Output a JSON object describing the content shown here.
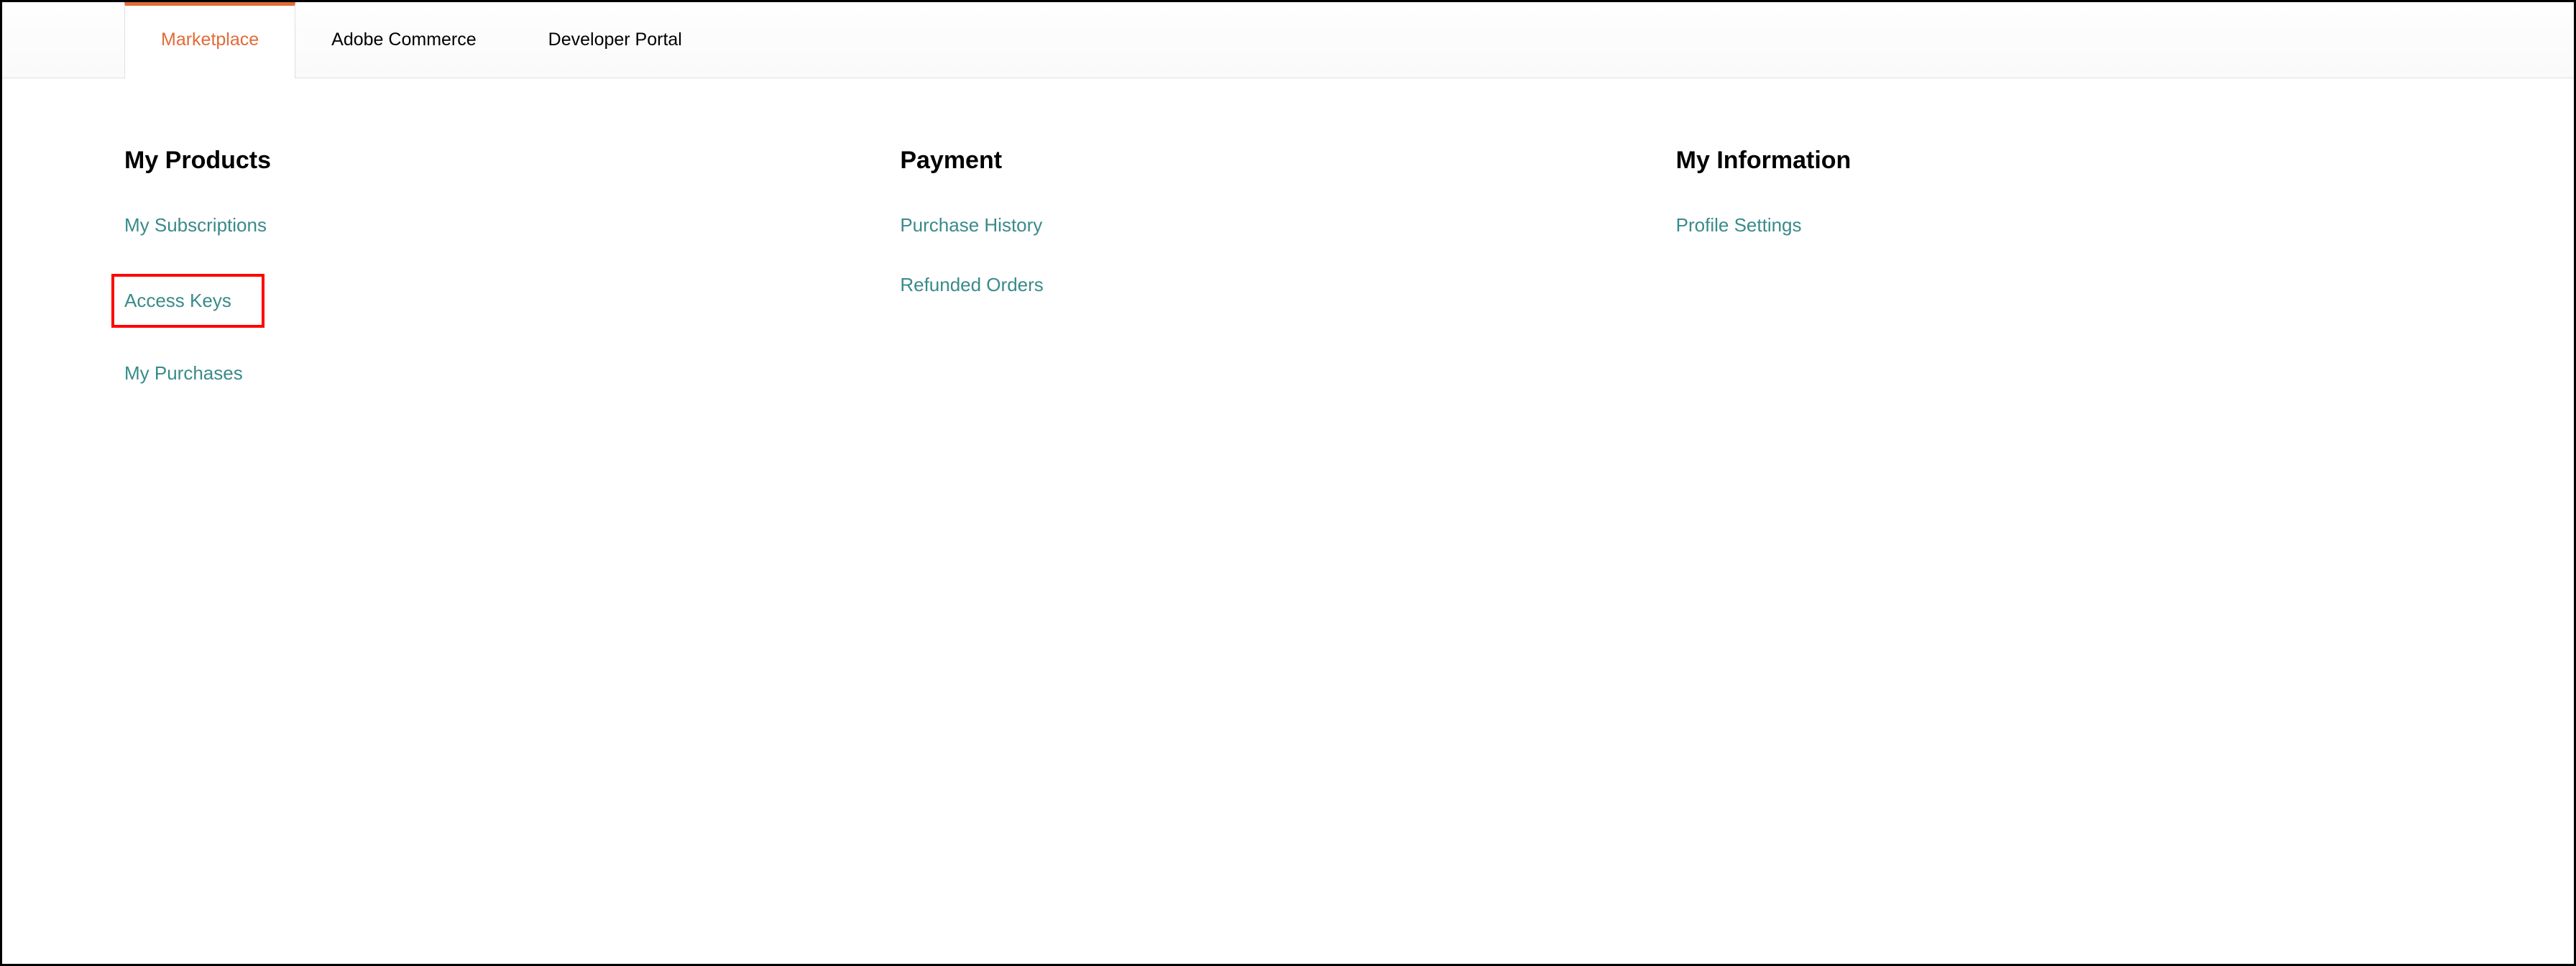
{
  "tabs": [
    {
      "label": "Marketplace",
      "active": true
    },
    {
      "label": "Adobe Commerce",
      "active": false
    },
    {
      "label": "Developer Portal",
      "active": false
    }
  ],
  "columns": {
    "products": {
      "heading": "My Products",
      "links": {
        "subscriptions": "My Subscriptions",
        "access_keys": "Access Keys",
        "my_purchases": "My Purchases"
      }
    },
    "payment": {
      "heading": "Payment",
      "links": {
        "purchase_history": "Purchase History",
        "refunded_orders": "Refunded Orders"
      }
    },
    "information": {
      "heading": "My Information",
      "links": {
        "profile_settings": "Profile Settings"
      }
    }
  }
}
